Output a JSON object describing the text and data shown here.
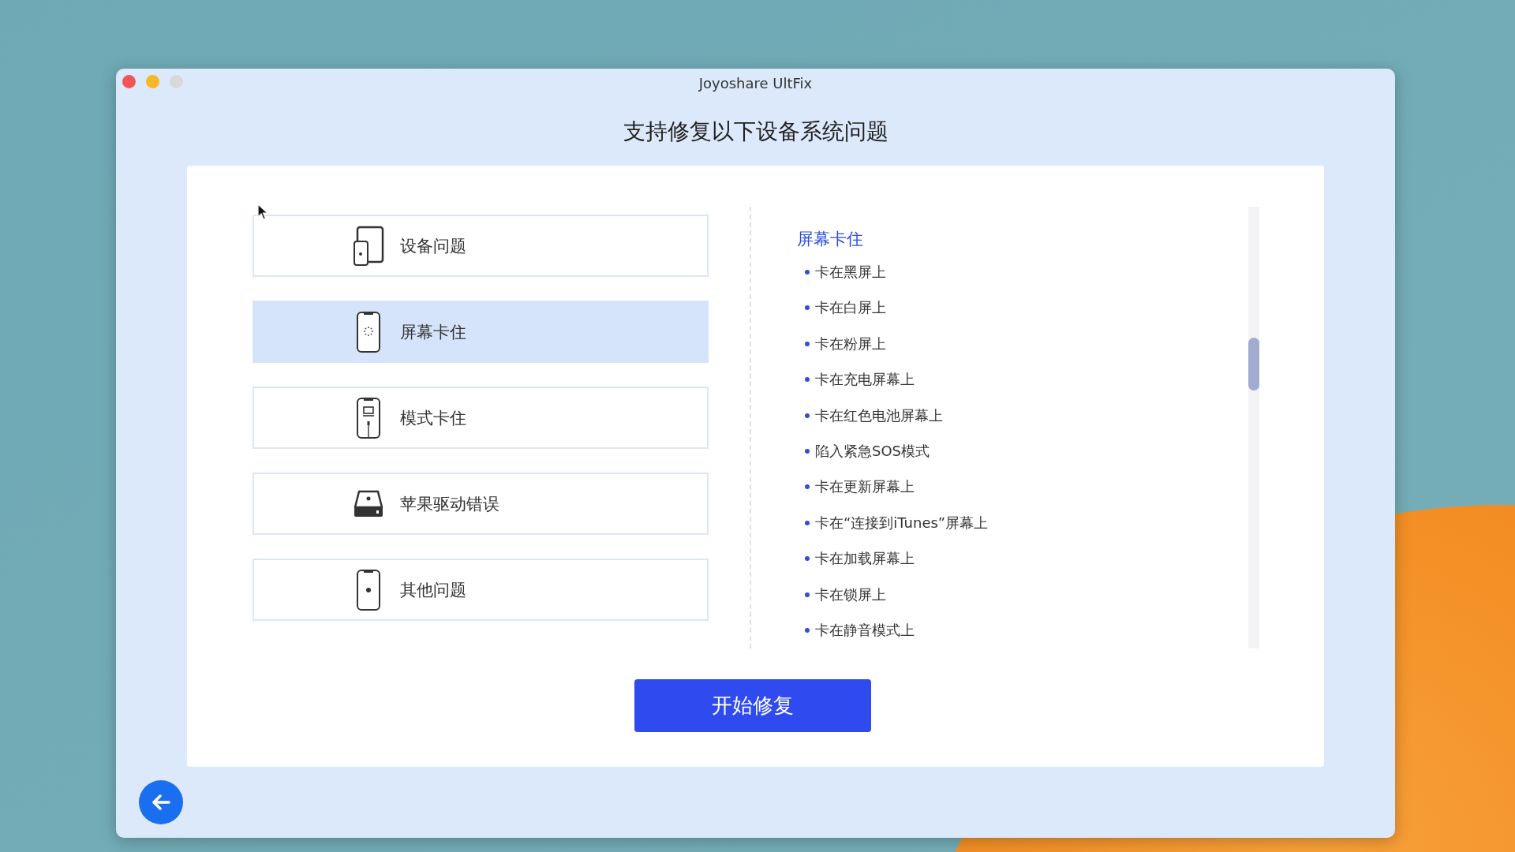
{
  "window": {
    "title": "Joyoshare UltFix"
  },
  "heading": "支持修复以下设备系统问题",
  "categories": [
    {
      "label": "设备问题",
      "selected": false
    },
    {
      "label": "屏幕卡住",
      "selected": true
    },
    {
      "label": "模式卡住",
      "selected": false
    },
    {
      "label": "苹果驱动错误",
      "selected": false
    },
    {
      "label": "其他问题",
      "selected": false
    }
  ],
  "detail": {
    "title": "屏幕卡住",
    "items": [
      "卡在黑屏上",
      "卡在白屏上",
      "卡在粉屏上",
      "卡在充电屏幕上",
      "卡在红色电池屏幕上",
      "陷入紧急SOS模式",
      "卡在更新屏幕上",
      "卡在“连接到iTunes”屏幕上",
      "卡在加载屏幕上",
      "卡在锁屏上",
      "卡在静音模式上"
    ]
  },
  "start_button": "开始修复"
}
